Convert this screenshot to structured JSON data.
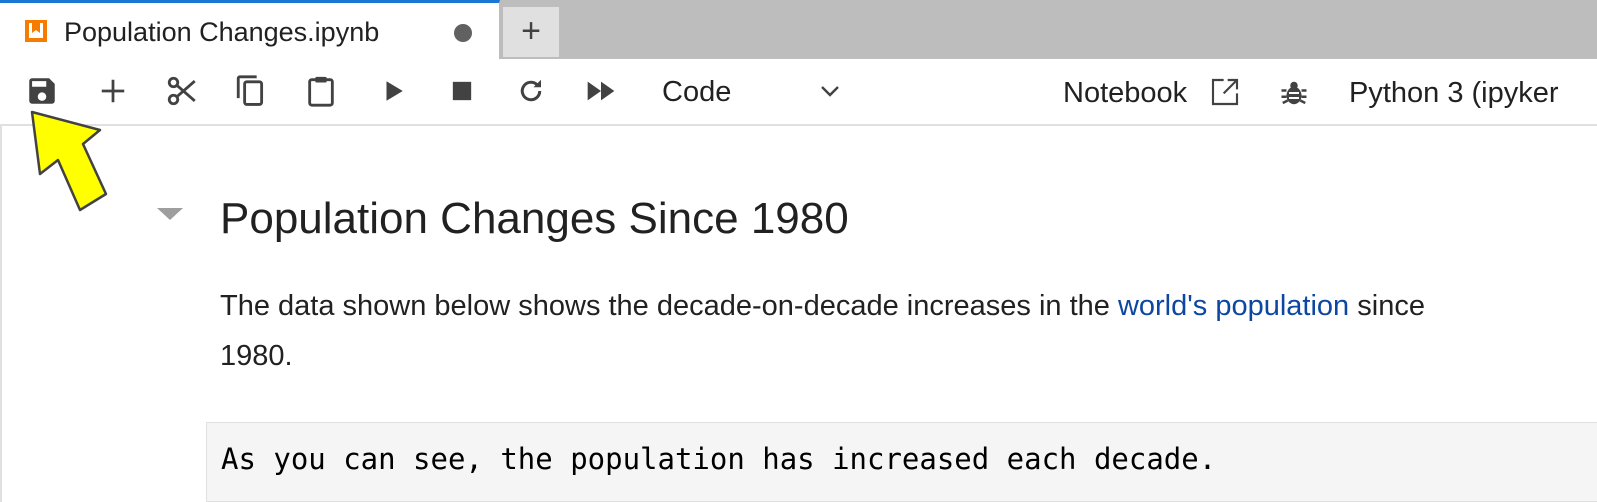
{
  "tab": {
    "title": "Population Changes.ipynb",
    "icon": "notebook-icon",
    "unsaved_indicator": "unsaved-dot-icon",
    "new_tab_label": "+"
  },
  "toolbar": {
    "buttons": [
      {
        "name": "save-button",
        "icon": "save-icon",
        "tooltip": "Save"
      },
      {
        "name": "insert-cell-button",
        "icon": "plus-icon",
        "tooltip": "Insert cell"
      },
      {
        "name": "cut-button",
        "icon": "scissors-icon",
        "tooltip": "Cut"
      },
      {
        "name": "copy-button",
        "icon": "copy-icon",
        "tooltip": "Copy"
      },
      {
        "name": "paste-button",
        "icon": "clipboard-icon",
        "tooltip": "Paste"
      },
      {
        "name": "run-button",
        "icon": "play-icon",
        "tooltip": "Run"
      },
      {
        "name": "interrupt-button",
        "icon": "stop-icon",
        "tooltip": "Interrupt"
      },
      {
        "name": "restart-button",
        "icon": "restart-icon",
        "tooltip": "Restart"
      },
      {
        "name": "restart-run-all-button",
        "icon": "fast-forward-icon",
        "tooltip": "Restart and run all"
      }
    ],
    "cell_type": "Code",
    "notebook_label": "Notebook",
    "kernel_label": "Python 3 (ipyker"
  },
  "notebook": {
    "heading": "Population Changes Since 1980",
    "paragraph": {
      "before_link": "The data shown below shows the decade-on-decade increases in the ",
      "link_text": "world's population",
      "after_link": " since",
      "line2": "1980."
    },
    "code": "As you can see, the population has increased each decade."
  },
  "colors": {
    "accent": "#1976d2",
    "link": "#0d47a1",
    "annotation_arrow": "#ffff00",
    "tab_icon": "#f57c00"
  }
}
